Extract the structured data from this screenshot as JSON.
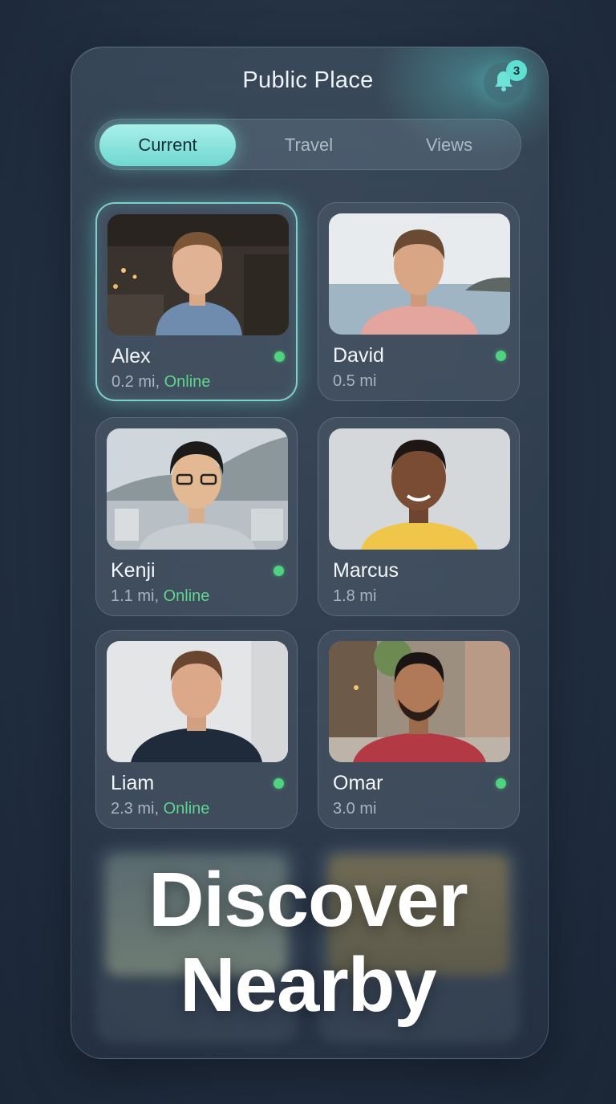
{
  "header": {
    "title": "Public Place",
    "notification_count": "3"
  },
  "tabs": [
    {
      "label": "Current",
      "active": true
    },
    {
      "label": "Travel",
      "active": false
    },
    {
      "label": "Views",
      "active": false
    }
  ],
  "profiles": [
    {
      "name": "Alex",
      "distance": "0.2 mi",
      "status": "Online",
      "online": true,
      "selected": true
    },
    {
      "name": "David",
      "distance": "0.5 mi",
      "status": "",
      "online": true,
      "selected": false
    },
    {
      "name": "Kenji",
      "distance": "1.1 mi",
      "status": "Online",
      "online": true,
      "selected": false
    },
    {
      "name": "Marcus",
      "distance": "1.8 mi",
      "status": "",
      "online": false,
      "selected": false
    },
    {
      "name": "Liam",
      "distance": "2.3 mi",
      "status": "Online",
      "online": true,
      "selected": false
    },
    {
      "name": "Omar",
      "distance": "3.0 mi",
      "status": "",
      "online": true,
      "selected": false
    }
  ],
  "promo": {
    "line1": "Discover",
    "line2": "Nearby"
  },
  "colors": {
    "accent": "#6fd8d1",
    "online": "#4fd37f",
    "background": "#223042"
  },
  "icons": {
    "notification": "bell-icon"
  }
}
